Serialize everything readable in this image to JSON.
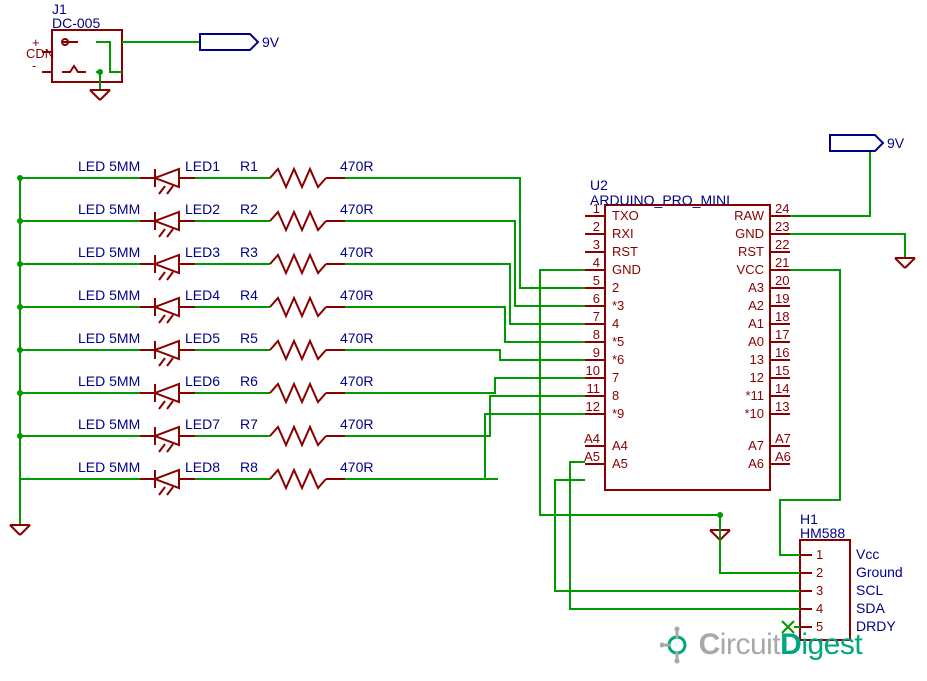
{
  "power": {
    "connector_ref": "J1",
    "connector_part": "DC-005",
    "voltage_tag": "9V"
  },
  "mcu": {
    "ref": "U2",
    "part": "ARDUINO_PRO_MINI",
    "pins_left": [
      {
        "num": "1",
        "name": "TXO"
      },
      {
        "num": "2",
        "name": "RXI"
      },
      {
        "num": "3",
        "name": "RST"
      },
      {
        "num": "4",
        "name": "GND"
      },
      {
        "num": "5",
        "name": "2"
      },
      {
        "num": "6",
        "name": "*3"
      },
      {
        "num": "7",
        "name": "4"
      },
      {
        "num": "8",
        "name": "*5"
      },
      {
        "num": "9",
        "name": "*6"
      },
      {
        "num": "10",
        "name": "7"
      },
      {
        "num": "11",
        "name": "8"
      },
      {
        "num": "12",
        "name": "*9"
      },
      {
        "num": "A4",
        "name": "A4"
      },
      {
        "num": "A5",
        "name": "A5"
      }
    ],
    "pins_right": [
      {
        "num": "24",
        "name": "RAW"
      },
      {
        "num": "23",
        "name": "GND"
      },
      {
        "num": "22",
        "name": "RST"
      },
      {
        "num": "21",
        "name": "VCC"
      },
      {
        "num": "20",
        "name": "A3"
      },
      {
        "num": "19",
        "name": "A2"
      },
      {
        "num": "18",
        "name": "A1"
      },
      {
        "num": "17",
        "name": "A0"
      },
      {
        "num": "16",
        "name": "13"
      },
      {
        "num": "15",
        "name": "12"
      },
      {
        "num": "14",
        "name": "*11"
      },
      {
        "num": "13",
        "name": "*10"
      },
      {
        "num": "A7",
        "name": "A7"
      },
      {
        "num": "A6",
        "name": "A6"
      }
    ]
  },
  "sensor": {
    "ref": "H1",
    "part": "HM588",
    "pins": [
      {
        "num": "1",
        "name": "Vcc"
      },
      {
        "num": "2",
        "name": "Ground"
      },
      {
        "num": "3",
        "name": "SCL"
      },
      {
        "num": "4",
        "name": "SDA"
      },
      {
        "num": "5",
        "name": "DRDY"
      }
    ]
  },
  "leds": [
    {
      "type": "LED 5MM",
      "ref": "LED1",
      "res": "R1",
      "rval": "470R"
    },
    {
      "type": "LED 5MM",
      "ref": "LED2",
      "res": "R2",
      "rval": "470R"
    },
    {
      "type": "LED 5MM",
      "ref": "LED3",
      "res": "R3",
      "rval": "470R"
    },
    {
      "type": "LED 5MM",
      "ref": "LED4",
      "res": "R4",
      "rval": "470R"
    },
    {
      "type": "LED 5MM",
      "ref": "LED5",
      "res": "R5",
      "rval": "470R"
    },
    {
      "type": "LED 5MM",
      "ref": "LED6",
      "res": "R6",
      "rval": "470R"
    },
    {
      "type": "LED 5MM",
      "ref": "LED7",
      "res": "R7",
      "rval": "470R"
    },
    {
      "type": "LED 5MM",
      "ref": "LED8",
      "res": "R8",
      "rval": "470R"
    }
  ],
  "logo": {
    "text1": "C",
    "text2": "ircuit",
    "text3": "D",
    "text4": "igest"
  }
}
